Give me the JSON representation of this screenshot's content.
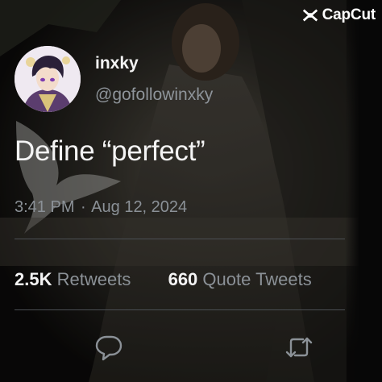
{
  "watermark": {
    "label": "CapCut",
    "icon": "capcut-logo-icon"
  },
  "tweet": {
    "display_name": "inxky",
    "handle": "@gofollowinxky",
    "text": "Define “perfect”",
    "time": "3:41 PM",
    "separator": "·",
    "date": "Aug 12, 2024"
  },
  "stats": {
    "retweets_count": "2.5K",
    "retweets_label": "Retweets",
    "quotes_count": "660",
    "quotes_label": "Quote Tweets"
  },
  "actions": [
    {
      "icon": "reply-icon"
    },
    {
      "icon": "retweet-icon"
    }
  ],
  "colors": {
    "secondary_text": "#8b9197",
    "primary_text": "#f4f4f4",
    "divider": "#4b4f54"
  }
}
